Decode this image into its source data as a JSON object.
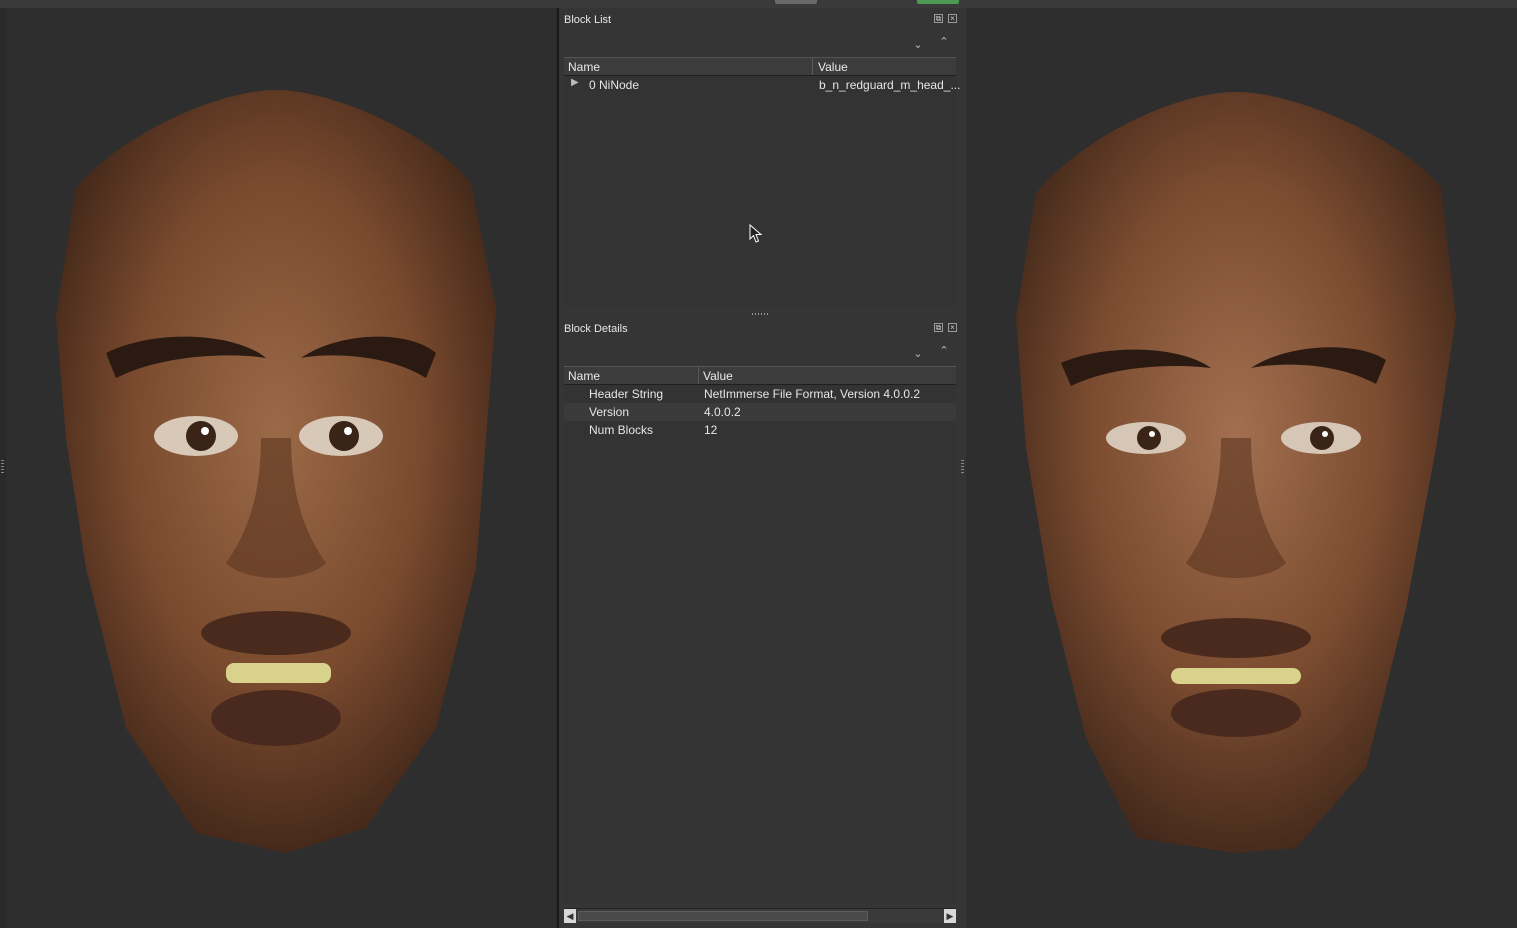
{
  "block_list": {
    "title": "Block List",
    "columns": [
      "Name",
      "Value"
    ],
    "rows": [
      {
        "name": "0 NiNode",
        "value": "b_n_redguard_m_head_..."
      }
    ]
  },
  "block_details": {
    "title": "Block Details",
    "columns": [
      "Name",
      "Value"
    ],
    "rows": [
      {
        "name": "Header String",
        "value": "NetImmerse File Format, Version 4.0.0.2"
      },
      {
        "name": "Version",
        "value": "4.0.0.2"
      },
      {
        "name": "Num Blocks",
        "value": "12"
      }
    ]
  },
  "icons": {
    "float": "float-icon",
    "close": "close-icon",
    "collapse": "chevron-down-icon",
    "expand": "chevron-up-icon",
    "expander": "triangle-right-icon",
    "cursor": "mouse-cursor-icon"
  },
  "colors": {
    "background": "#2a2a2a",
    "panel": "#353535",
    "skin": "#7a4a2e",
    "accent_tab": "#4c9a52"
  }
}
